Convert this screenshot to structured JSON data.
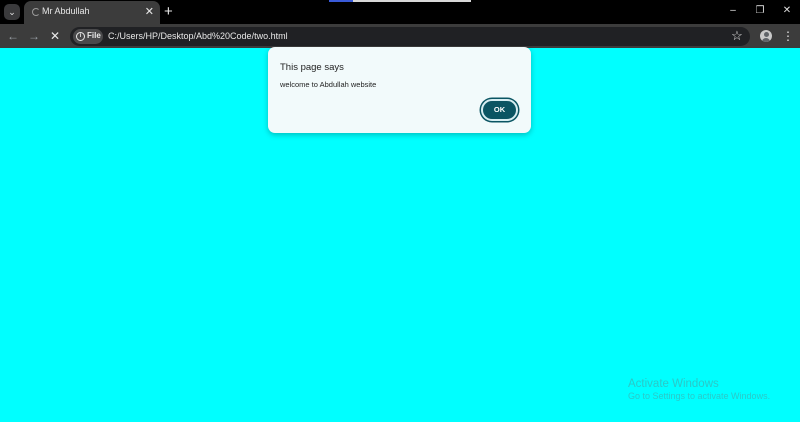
{
  "browser": {
    "tab": {
      "title": "Mr Abdullah",
      "close_glyph": "✕"
    },
    "new_tab_glyph": "+",
    "tab_search_glyph": "⌄",
    "window_controls": {
      "minimize": "–",
      "restore": "❐",
      "close": "✕"
    },
    "nav": {
      "back": "←",
      "forward": "→",
      "stop": "✕"
    },
    "address": {
      "chip_icon": "i",
      "chip_label": "File",
      "url": "C:/Users/HP/Desktop/Abd%20Code/two.html"
    },
    "bookmark_glyph": "☆",
    "menu_glyph": "⋮"
  },
  "page": {
    "background_color": "#00ffff"
  },
  "dialog": {
    "title": "This page says",
    "message": "welcome to Abdullah website",
    "ok_label": "OK",
    "button_color": "#0b5563"
  },
  "watermark": {
    "title": "Activate Windows",
    "subtitle": "Go to Settings to activate Windows."
  }
}
